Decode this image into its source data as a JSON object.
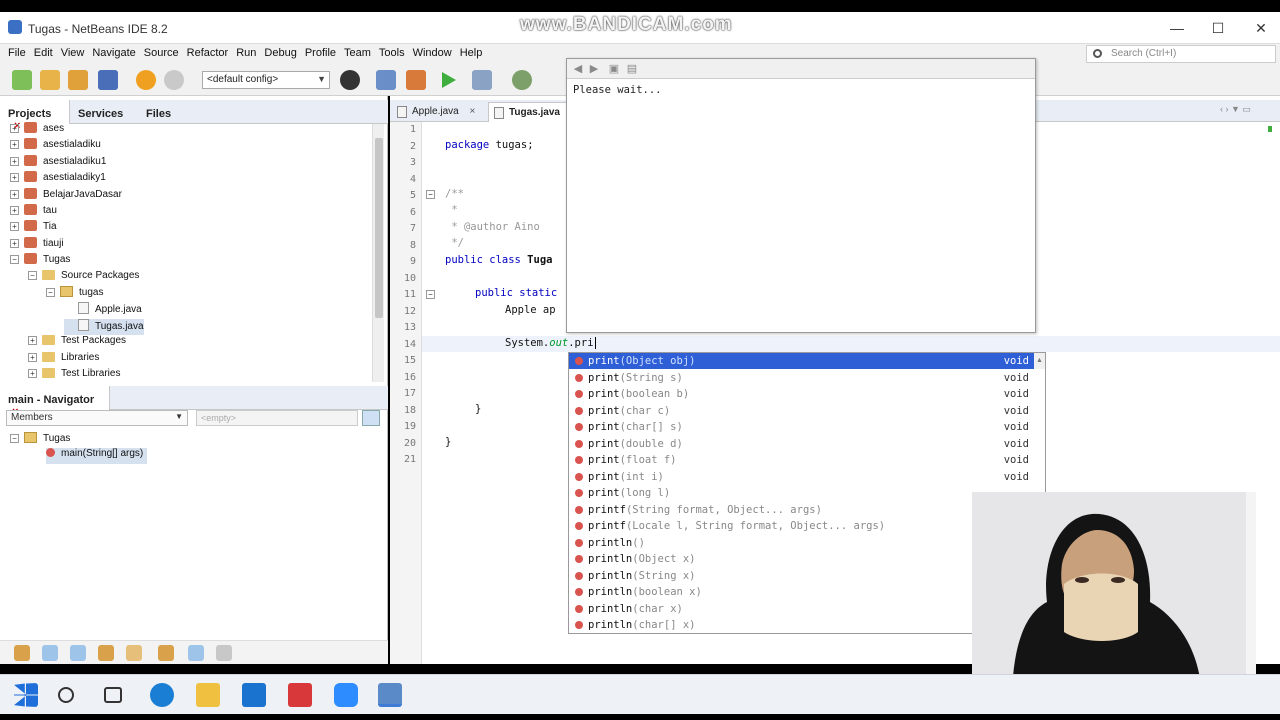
{
  "watermark": "www.BANDICAM.com",
  "window": {
    "title": "Tugas - NetBeans IDE 8.2",
    "min": "—",
    "max": "☐",
    "close": "✕"
  },
  "menu": [
    "File",
    "Edit",
    "View",
    "Navigate",
    "Source",
    "Refactor",
    "Run",
    "Debug",
    "Profile",
    "Team",
    "Tools",
    "Window",
    "Help"
  ],
  "search": {
    "placeholder": "Search (Ctrl+I)"
  },
  "toolbar": {
    "config": "<default config>"
  },
  "projects_panel": {
    "tabs": [
      "Projects",
      "Services",
      "Files"
    ],
    "close": "×",
    "items": [
      {
        "label": "ases",
        "type": "project",
        "depth": 0,
        "exp": "+"
      },
      {
        "label": "asestialadiku",
        "type": "project",
        "depth": 0,
        "exp": "+"
      },
      {
        "label": "asestialadiku1",
        "type": "project",
        "depth": 0,
        "exp": "+"
      },
      {
        "label": "asestialadiky1",
        "type": "project",
        "depth": 0,
        "exp": "+"
      },
      {
        "label": "BelajarJavaDasar",
        "type": "project",
        "depth": 0,
        "exp": "+"
      },
      {
        "label": "tau",
        "type": "project",
        "depth": 0,
        "exp": "+"
      },
      {
        "label": "Tia",
        "type": "project",
        "depth": 0,
        "exp": "+"
      },
      {
        "label": "tiauji",
        "type": "project",
        "depth": 0,
        "exp": "+"
      },
      {
        "label": "Tugas",
        "type": "project",
        "depth": 0,
        "exp": "−"
      },
      {
        "label": "Source Packages",
        "type": "folder",
        "depth": 1,
        "exp": "−"
      },
      {
        "label": "tugas",
        "type": "package",
        "depth": 2,
        "exp": "−"
      },
      {
        "label": "Apple.java",
        "type": "file",
        "depth": 3,
        "exp": ""
      },
      {
        "label": "Tugas.java",
        "type": "file",
        "depth": 3,
        "exp": "",
        "selected": true
      },
      {
        "label": "Test Packages",
        "type": "folder",
        "depth": 1,
        "exp": "+"
      },
      {
        "label": "Libraries",
        "type": "folder",
        "depth": 1,
        "exp": "+"
      },
      {
        "label": "Test Libraries",
        "type": "folder",
        "depth": 1,
        "exp": "+"
      }
    ]
  },
  "navigator": {
    "title": "main - Navigator",
    "close": "×",
    "members_label": "Members",
    "filter_placeholder": "<empty>",
    "root": "Tugas",
    "member": "main(String[] args)"
  },
  "editor": {
    "tabs": [
      {
        "label": "Apple.java",
        "active": false
      },
      {
        "label": "Tugas.java",
        "active": true
      }
    ],
    "tab_close": "×",
    "line_numbers": [
      "1",
      "2",
      "3",
      "4",
      "5",
      "6",
      "7",
      "8",
      "9",
      "10",
      "11",
      "12",
      "13",
      "14",
      "15",
      "16",
      "17",
      "18",
      "19",
      "20",
      "21"
    ],
    "code": {
      "l2a": "package",
      "l2b": " tugas;",
      "l5": "/**",
      "l6": " *",
      "l7": " * @author Aino",
      "l8": " */",
      "l9a": "public class",
      "l9b": " Tuga",
      "l11": "public static",
      "l12": "Apple ap",
      "l14a": "System.",
      "l14b": "out",
      "l14c": ".pri",
      "l18": "}",
      "l20": "}"
    }
  },
  "doc_popup": {
    "message": "Please wait..."
  },
  "completion": [
    {
      "name": "print",
      "params": "(Object obj)",
      "ret": "void"
    },
    {
      "name": "print",
      "params": "(String s)",
      "ret": "void"
    },
    {
      "name": "print",
      "params": "(boolean b)",
      "ret": "void"
    },
    {
      "name": "print",
      "params": "(char c)",
      "ret": "void"
    },
    {
      "name": "print",
      "params": "(char[] s)",
      "ret": "void"
    },
    {
      "name": "print",
      "params": "(double d)",
      "ret": "void"
    },
    {
      "name": "print",
      "params": "(float f)",
      "ret": "void"
    },
    {
      "name": "print",
      "params": "(int i)",
      "ret": "void"
    },
    {
      "name": "print",
      "params": "(long l)",
      "ret": ""
    },
    {
      "name": "printf",
      "params": "(String format, Object... args)",
      "ret": "Prin"
    },
    {
      "name": "printf",
      "params": "(Locale l, String format, Object... args)",
      "ret": "Prin"
    },
    {
      "name": "println",
      "params": "()",
      "ret": ""
    },
    {
      "name": "println",
      "params": "(Object x)",
      "ret": ""
    },
    {
      "name": "println",
      "params": "(String x)",
      "ret": ""
    },
    {
      "name": "println",
      "params": "(boolean x)",
      "ret": ""
    },
    {
      "name": "println",
      "params": "(char x)",
      "ret": ""
    },
    {
      "name": "println",
      "params": "(char[] x)",
      "ret": ""
    }
  ]
}
